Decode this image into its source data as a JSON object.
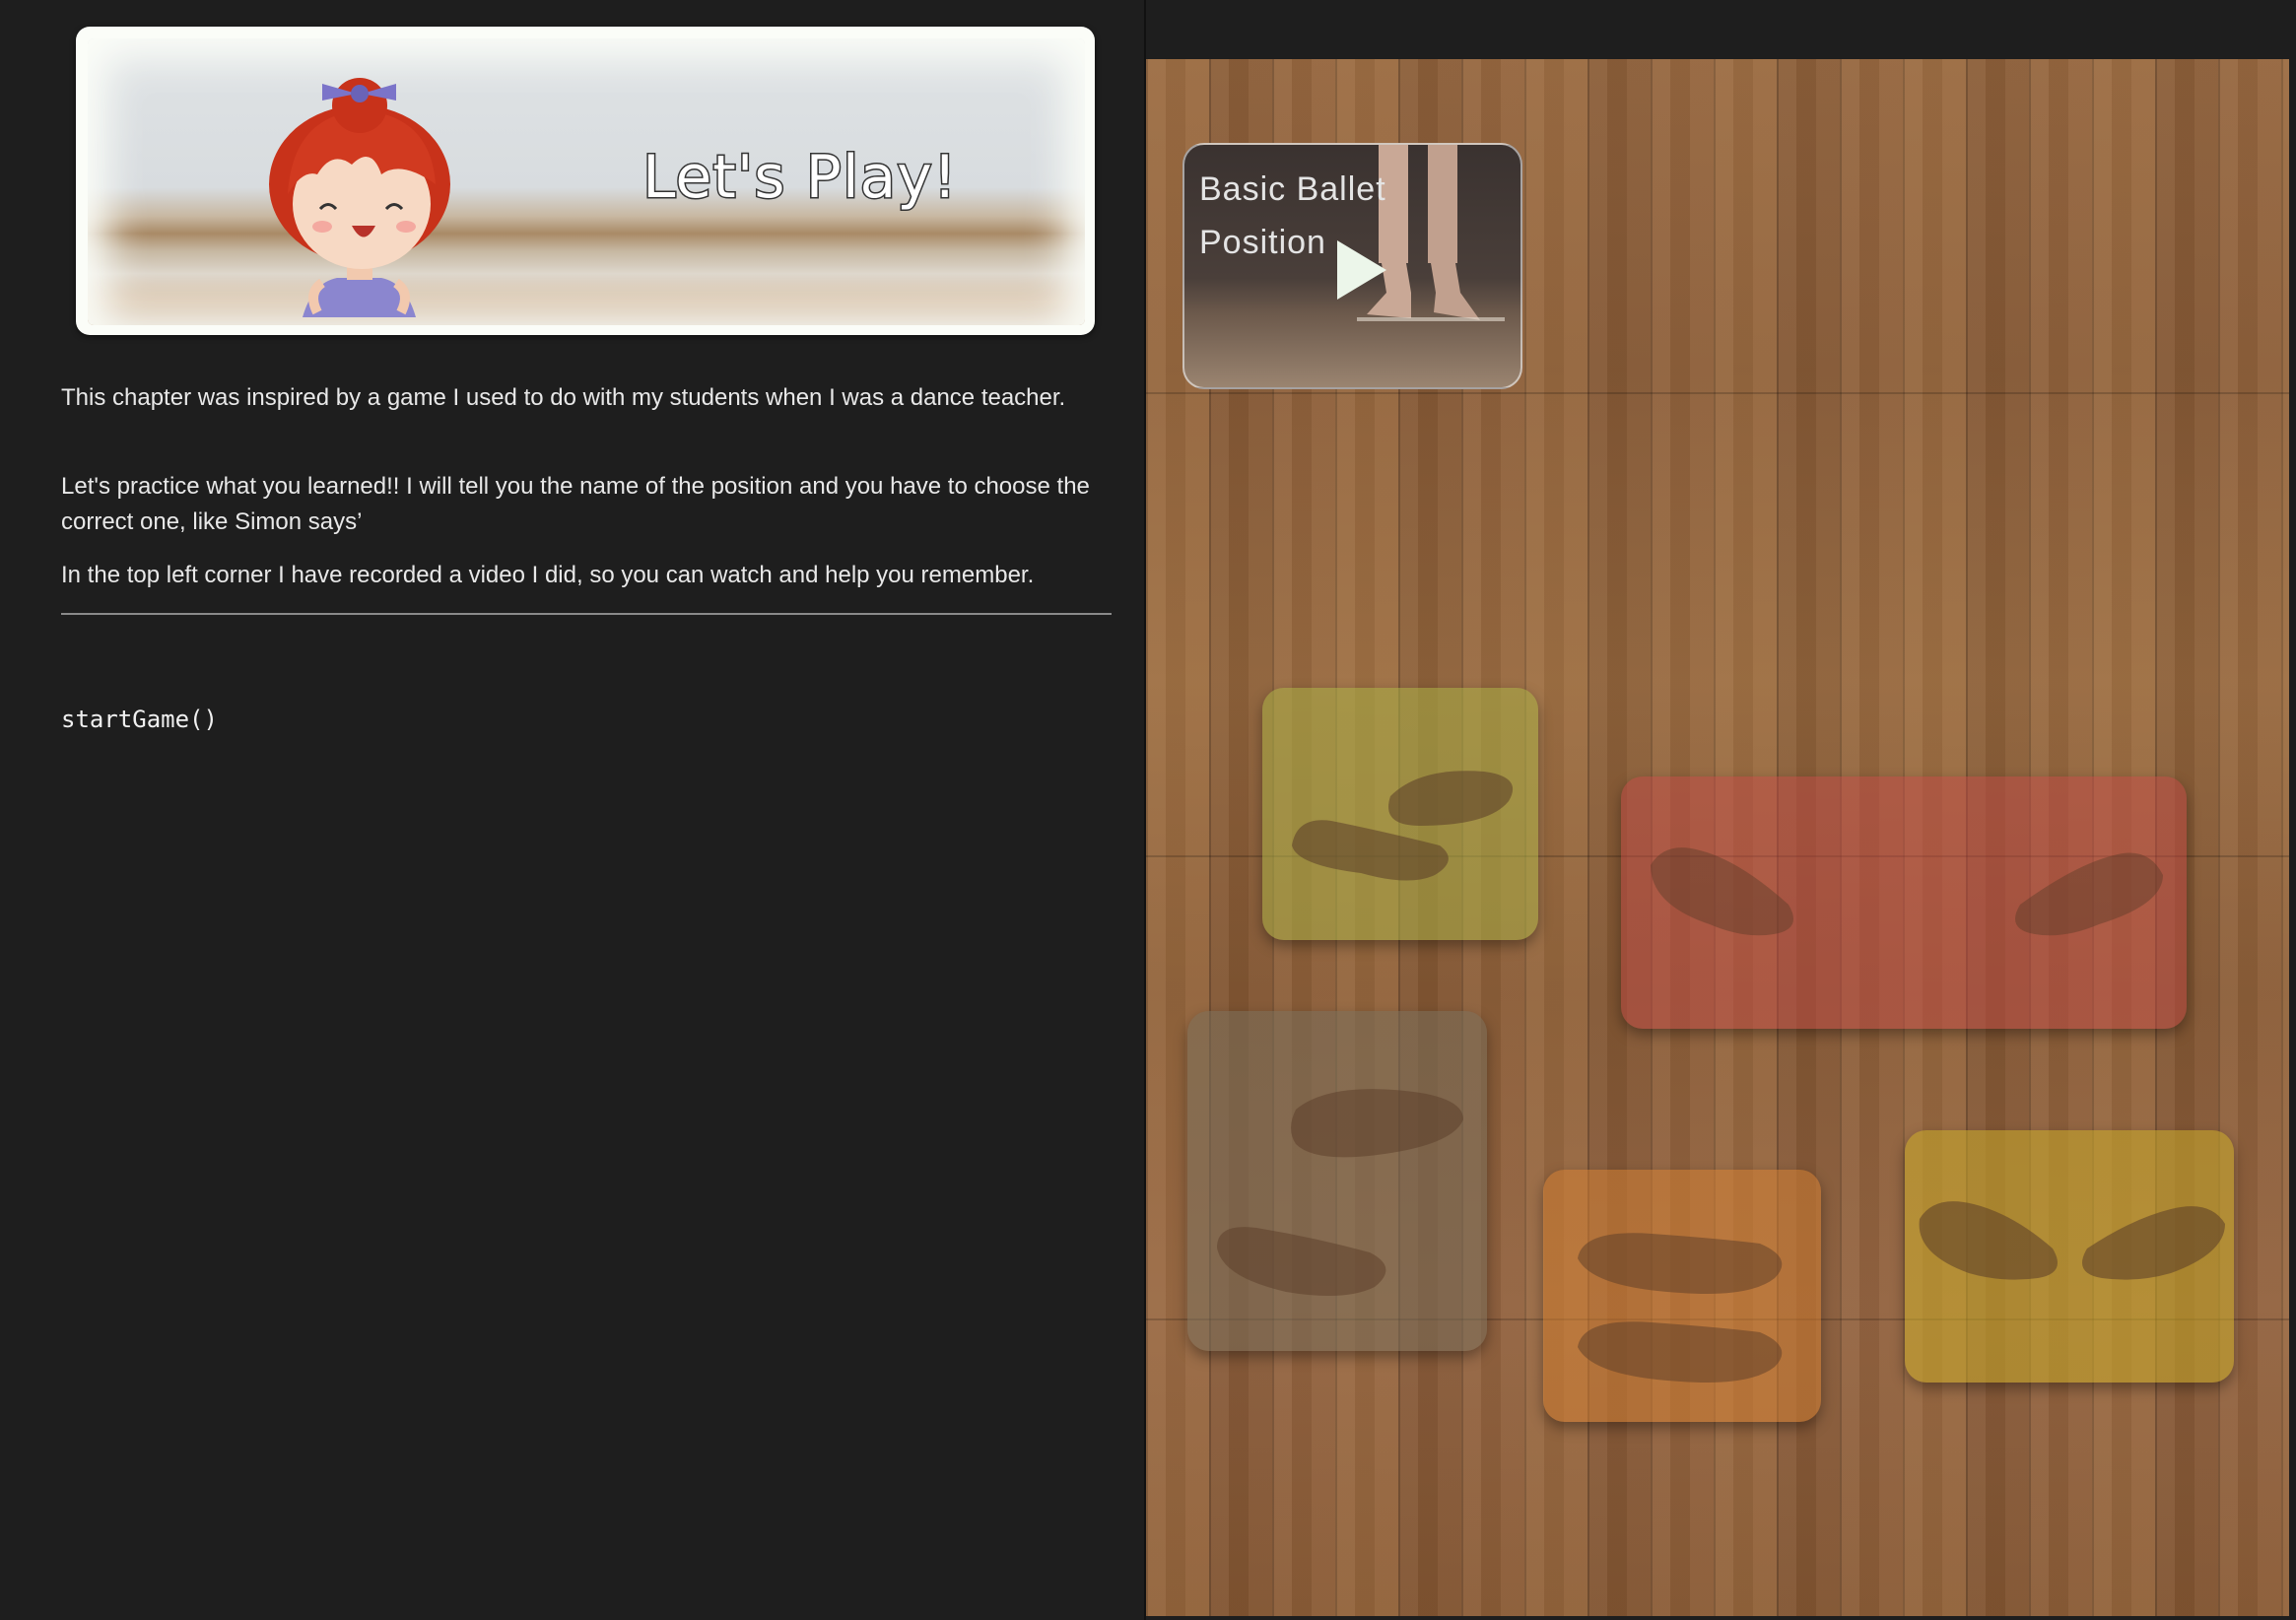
{
  "banner": {
    "title": "Let's Play!"
  },
  "intro": {
    "paragraphs": [
      "This chapter was inspired by a game I used to do with my students when I was a dance teacher.",
      "Let's practice what you learned!! I will tell you the name of the position and you have to choose the correct one, like Simon says’",
      "In the top left corner I have recorded a video I did, so you can watch and help you remember."
    ]
  },
  "code": {
    "line": "startGame()"
  },
  "game": {
    "video": {
      "title": "Basic Ballet Position",
      "icon": "play-icon"
    },
    "pads": [
      {
        "name": "green-pad",
        "color": "#a9ad44"
      },
      {
        "name": "red-pad",
        "color": "#c84646"
      },
      {
        "name": "gray-pad",
        "color": "#786e5a"
      },
      {
        "name": "orange-pad",
        "color": "#d78232"
      },
      {
        "name": "yellow-pad",
        "color": "#c8aa28"
      }
    ]
  }
}
